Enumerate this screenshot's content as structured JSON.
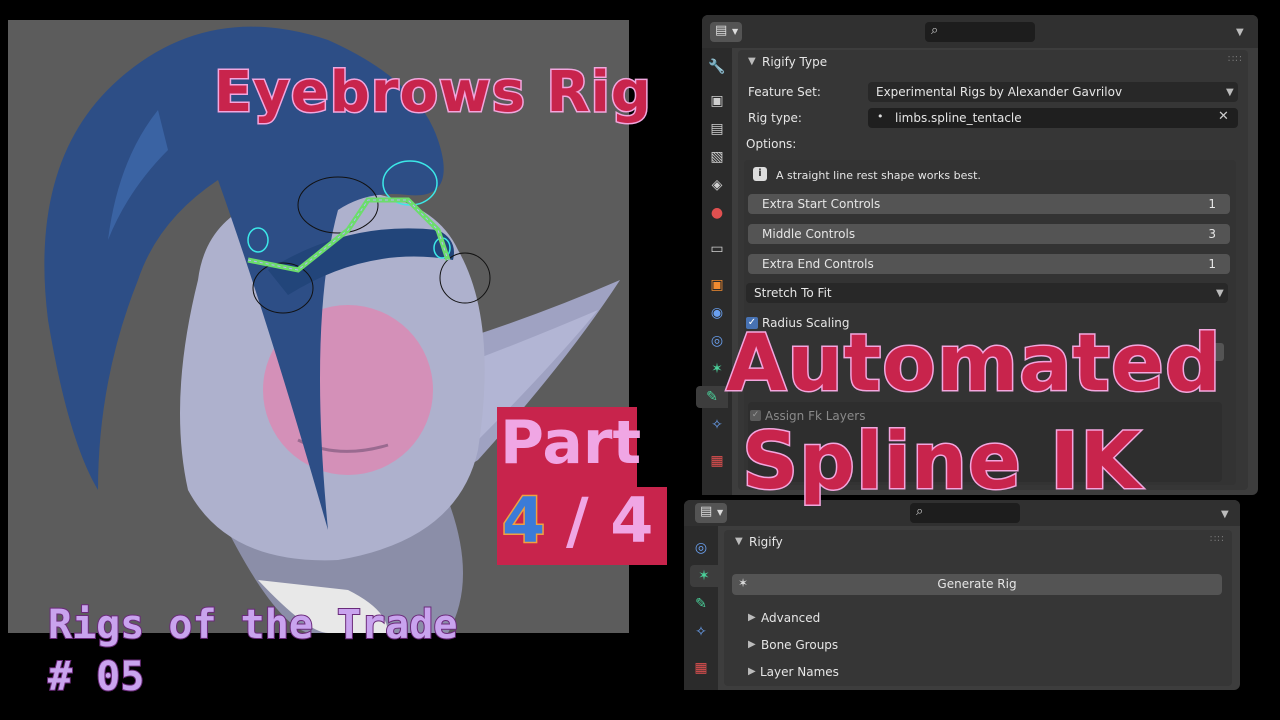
{
  "overlay": {
    "title_eyebrows": "Eyebrows Rig",
    "title_automated": "Automated",
    "title_spline": "Spline IK",
    "part_word": "Part",
    "part_num": "4",
    "part_den": "/ 4",
    "series_line1": "Rigs of the Trade",
    "series_line2": "# 05"
  },
  "properties_panel": {
    "section_title": "Rigify Type",
    "feature_set_label": "Feature Set:",
    "feature_set_value": "Experimental Rigs by Alexander Gavrilov",
    "rig_type_label": "Rig type:",
    "rig_type_value": "limbs.spline_tentacle",
    "options_label": "Options:",
    "info_text": "A straight line rest shape works best.",
    "fields": [
      {
        "label": "Extra Start Controls",
        "value": "1"
      },
      {
        "label": "Middle Controls",
        "value": "3"
      },
      {
        "label": "Extra End Controls",
        "value": "1"
      }
    ],
    "stretch_dropdown": "Stretch To Fit",
    "radius_scaling_label": "Radius Scaling",
    "assign_fk_label": "Assign Fk Layers"
  },
  "rigify_panel": {
    "section_title": "Rigify",
    "generate_button": "Generate Rig",
    "subsections": [
      "Advanced",
      "Bone Groups",
      "Layer Names"
    ]
  },
  "colors": {
    "title_fill": "#c8244c",
    "title_stroke": "#f2a6de",
    "panel_bg": "#3d3d3d",
    "viewport_bg": "#5c5c5c",
    "accent_blue": "#4772b3"
  }
}
